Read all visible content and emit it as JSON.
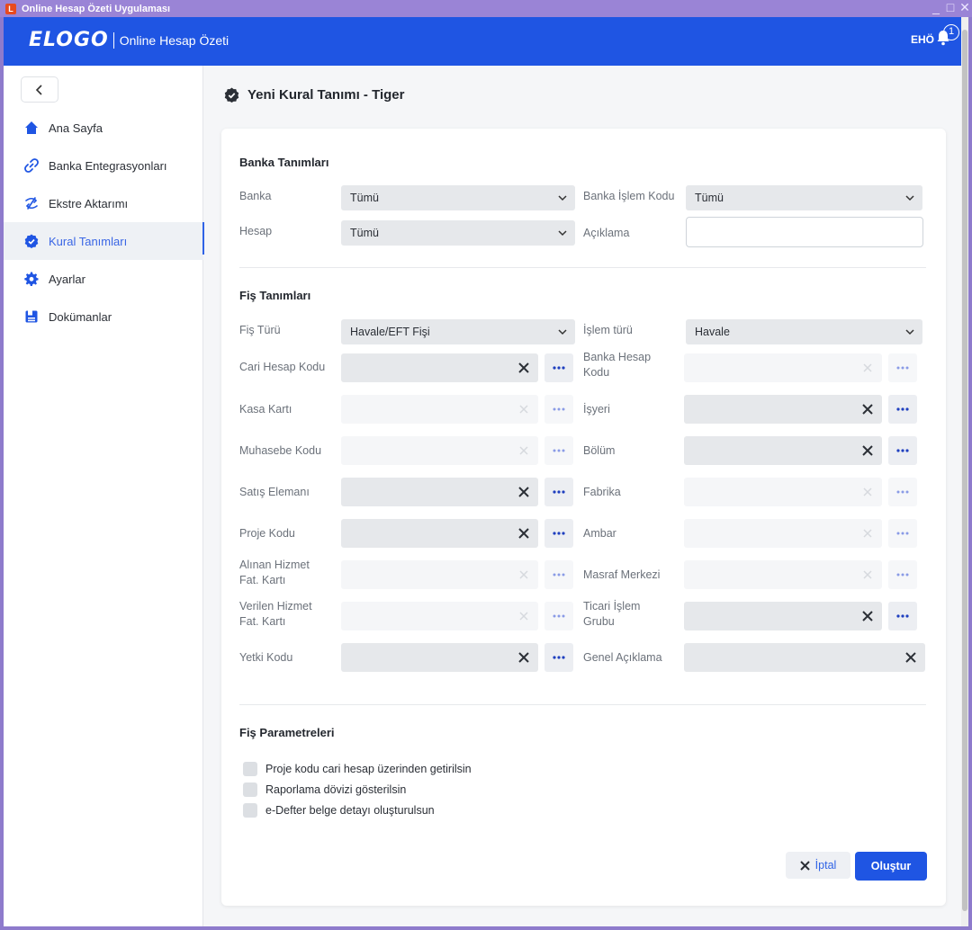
{
  "window": {
    "title": "Online Hesap Özeti Uygulaması",
    "min": "_",
    "max": "□",
    "close": "✕"
  },
  "header": {
    "logo": "ELOGO",
    "app_name": "Online Hesap Özeti",
    "user": "EHÖ",
    "notification_count": "1"
  },
  "sidebar": {
    "items": [
      {
        "label": "Ana Sayfa",
        "icon": "home-icon"
      },
      {
        "label": "Banka Entegrasyonları",
        "icon": "link-icon"
      },
      {
        "label": "Ekstre Aktarımı",
        "icon": "transfer-icon"
      },
      {
        "label": "Kural Tanımları",
        "icon": "verified-icon",
        "active": true
      },
      {
        "label": "Ayarlar",
        "icon": "gear-icon"
      },
      {
        "label": "Dokümanlar",
        "icon": "document-icon"
      }
    ]
  },
  "page": {
    "title": "Yeni Kural Tanımı - Tiger"
  },
  "bank_section": {
    "title": "Banka Tanımları",
    "banka_label": "Banka",
    "banka_value": "Tümü",
    "islem_kodu_label": "Banka İşlem Kodu",
    "islem_kodu_value": "Tümü",
    "hesap_label": "Hesap",
    "hesap_value": "Tümü",
    "aciklama_label": "Açıklama",
    "aciklama_value": ""
  },
  "fis_section": {
    "title": "Fiş Tanımları",
    "fis_turu_label": "Fiş Türü",
    "fis_turu_value": "Havale/EFT Fişi",
    "islem_turu_label": "İşlem türü",
    "islem_turu_value": "Havale",
    "left": [
      {
        "label": "Cari Hesap Kodu",
        "enabled": true
      },
      {
        "label": "Kasa Kartı",
        "enabled": false
      },
      {
        "label": "Muhasebe Kodu",
        "enabled": false
      },
      {
        "label": "Satış Elemanı",
        "enabled": true
      },
      {
        "label": "Proje Kodu",
        "enabled": true
      },
      {
        "label": "Alınan Hizmet Fat. Kartı",
        "enabled": false
      },
      {
        "label": "Verilen Hizmet Fat. Kartı",
        "enabled": false
      },
      {
        "label": "Yetki Kodu",
        "enabled": true
      }
    ],
    "right": [
      {
        "label": "Banka Hesap Kodu",
        "enabled": false
      },
      {
        "label": "İşyeri",
        "enabled": true
      },
      {
        "label": "Bölüm",
        "enabled": true
      },
      {
        "label": "Fabrika",
        "enabled": false
      },
      {
        "label": "Ambar",
        "enabled": false
      },
      {
        "label": "Masraf Merkezi",
        "enabled": false
      },
      {
        "label": "Ticari İşlem Grubu",
        "enabled": true
      },
      {
        "label": "Genel Açıklama",
        "enabled": true
      }
    ]
  },
  "params_section": {
    "title": "Fiş Parametreleri",
    "options": [
      {
        "label": "Proje kodu cari hesap üzerinden getirilsin",
        "checked": false
      },
      {
        "label": "Raporlama dövizi gösterilsin",
        "checked": false
      },
      {
        "label": "e-Defter belge detayı oluşturulsun",
        "checked": false
      }
    ]
  },
  "actions": {
    "cancel": "İptal",
    "create": "Oluştur"
  },
  "colors": {
    "brand": "#1f55e3",
    "accent": "#2f63e6",
    "titlebar": "#9a84d6"
  }
}
